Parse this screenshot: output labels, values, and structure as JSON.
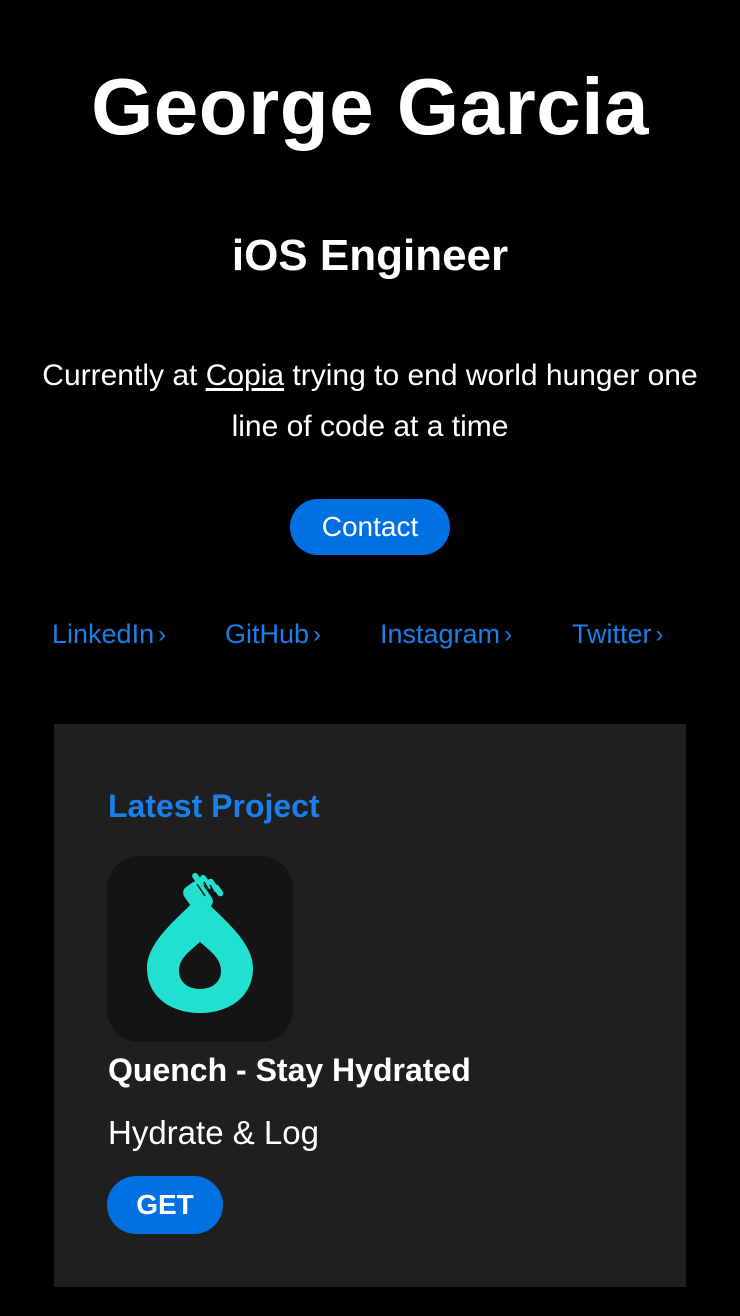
{
  "profile": {
    "name": "George Garcia",
    "role": "iOS Engineer",
    "bio_prefix": "Currently at ",
    "bio_link": "Copia",
    "bio_suffix": " trying to end world hunger one line of code at a time"
  },
  "contact": {
    "label": "Contact"
  },
  "social_links": [
    {
      "label": "LinkedIn",
      "chevron": "›"
    },
    {
      "label": "GitHub",
      "chevron": "›"
    },
    {
      "label": "Instagram",
      "chevron": "›"
    },
    {
      "label": "Twitter",
      "chevron": "›"
    }
  ],
  "project": {
    "heading": "Latest Project",
    "icon": "water-drop-hand-icon",
    "app_name": "Quench - Stay Hydrated",
    "subtitle": "Hydrate & Log",
    "get_label": "GET"
  },
  "colors": {
    "background": "#000000",
    "card": "#1f1f1f",
    "accent": "#0071e3",
    "link": "#1a7fe8",
    "app_icon_drop": "#22e0cf"
  }
}
